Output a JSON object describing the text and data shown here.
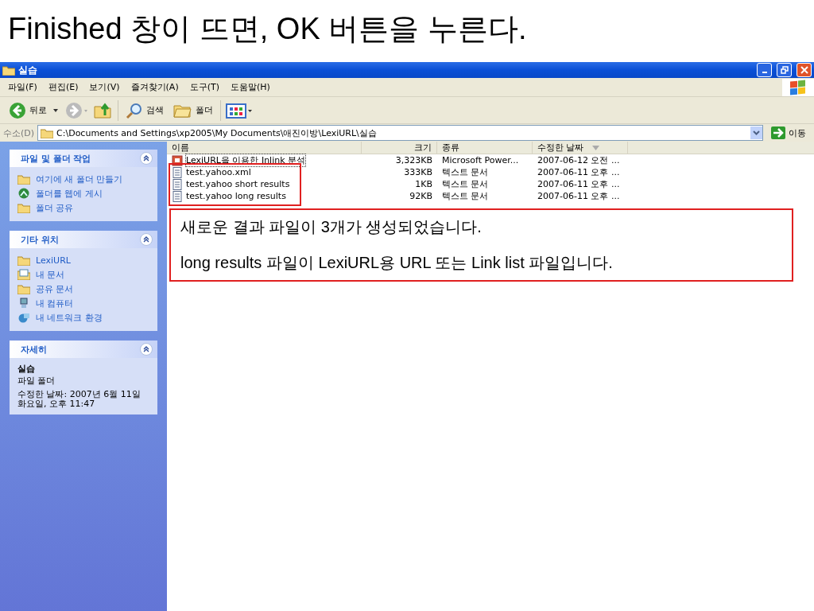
{
  "slide_title": "Finished 창이 뜨면, OK 버튼을 누른다.",
  "window": {
    "title": "실습"
  },
  "menu": [
    "파일(F)",
    "편집(E)",
    "보기(V)",
    "즐겨찾기(A)",
    "도구(T)",
    "도움말(H)"
  ],
  "toolbar": {
    "back": "뒤로",
    "search": "검색",
    "folders": "폴더"
  },
  "address": {
    "label": "수소(D)",
    "value": "C:\\Documents and Settings\\xp2005\\My Documents\\애진이방\\LexiURL\\실습",
    "go": "이동"
  },
  "sidebar": [
    {
      "kind": "tasks",
      "title": "파일 및 폴더 작업",
      "items": [
        {
          "kind": "folder",
          "label": "여기에 새 폴더 만들기"
        },
        {
          "kind": "globe",
          "label": "폴더를 웹에 게시"
        },
        {
          "kind": "folder",
          "label": "폴더 공유"
        }
      ]
    },
    {
      "kind": "tasks",
      "title": "기타 위치",
      "items": [
        {
          "kind": "folder",
          "label": "LexiURL"
        },
        {
          "kind": "documents",
          "label": "내 문서"
        },
        {
          "kind": "folder",
          "label": "공유 문서"
        },
        {
          "kind": "computer",
          "label": "내 컴퓨터"
        },
        {
          "kind": "network",
          "label": "내 네트워크 환경"
        }
      ]
    },
    {
      "kind": "details",
      "title": "자세히",
      "name": "실습",
      "type": "파일 폴더",
      "modified": "수정한 날짜: 2007년 6월 11일 화요일, 오후 11:47"
    }
  ],
  "table": {
    "columns": [
      {
        "label": "이름",
        "sorted": false
      },
      {
        "label": "크기",
        "sorted": false
      },
      {
        "label": "종류",
        "sorted": false
      },
      {
        "label": "수정한 날짜",
        "sorted": true
      }
    ],
    "rows": [
      {
        "kind": "presentation",
        "focused": true,
        "cells": [
          "LexiURL을 이용한 Inlink 분석",
          "3,323KB",
          "Microsoft Power...",
          "2007-06-12 오전 ..."
        ]
      },
      {
        "kind": "text",
        "focused": false,
        "cells": [
          "test.yahoo.xml",
          "333KB",
          "텍스트 문서",
          "2007-06-11 오후 ..."
        ]
      },
      {
        "kind": "text",
        "focused": false,
        "cells": [
          "test.yahoo short results",
          "1KB",
          "텍스트 문서",
          "2007-06-11 오후 ..."
        ]
      },
      {
        "kind": "text",
        "focused": false,
        "cells": [
          "test.yahoo long results",
          "92KB",
          "텍스트 문서",
          "2007-06-11 오후 ..."
        ]
      }
    ]
  },
  "callout": [
    "새로운 결과 파일이 3개가 생성되었습니다.",
    "long results 파일이 LexiURL용 URL 또는 Link list 파일입니다."
  ]
}
